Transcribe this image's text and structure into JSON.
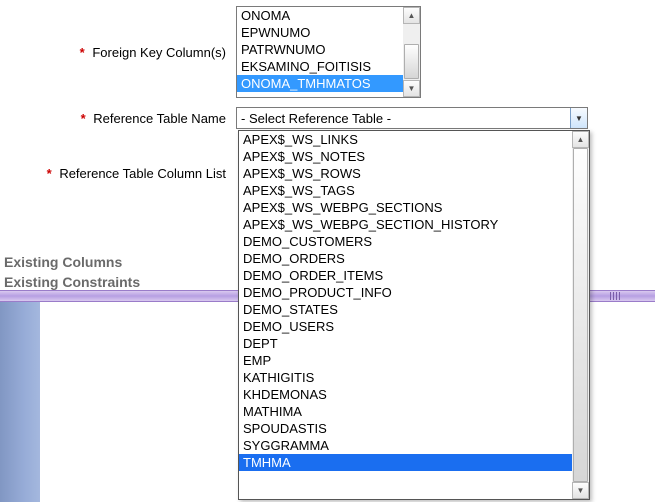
{
  "labels": {
    "foreign_key_columns": "Foreign Key Column(s)",
    "reference_table_name": "Reference Table Name",
    "reference_table_column_list": "Reference Table Column List"
  },
  "foreign_key_listbox": {
    "items": [
      "ONOMA",
      "EPWNUMO",
      "PATRWNUMO",
      "EKSAMINO_FOITISIS",
      "ONOMA_TMHMATOS"
    ],
    "selected_index": 4
  },
  "reference_table_select": {
    "current": "- Select Reference Table -",
    "options": [
      "APEX$_WS_LINKS",
      "APEX$_WS_NOTES",
      "APEX$_WS_ROWS",
      "APEX$_WS_TAGS",
      "APEX$_WS_WEBPG_SECTIONS",
      "APEX$_WS_WEBPG_SECTION_HISTORY",
      "DEMO_CUSTOMERS",
      "DEMO_ORDERS",
      "DEMO_ORDER_ITEMS",
      "DEMO_PRODUCT_INFO",
      "DEMO_STATES",
      "DEMO_USERS",
      "DEPT",
      "EMP",
      "KATHIGITIS",
      "KHDEMONAS",
      "MATHIMA",
      "SPOUDASTIS",
      "SYGGRAMMA",
      "TMHMA"
    ],
    "highlighted_index": 19
  },
  "sections": {
    "existing_columns": "Existing Columns",
    "existing_constraints": "Existing Constraints"
  },
  "glyphs": {
    "star": "*",
    "tri_up": "▲",
    "tri_down": "▼"
  }
}
